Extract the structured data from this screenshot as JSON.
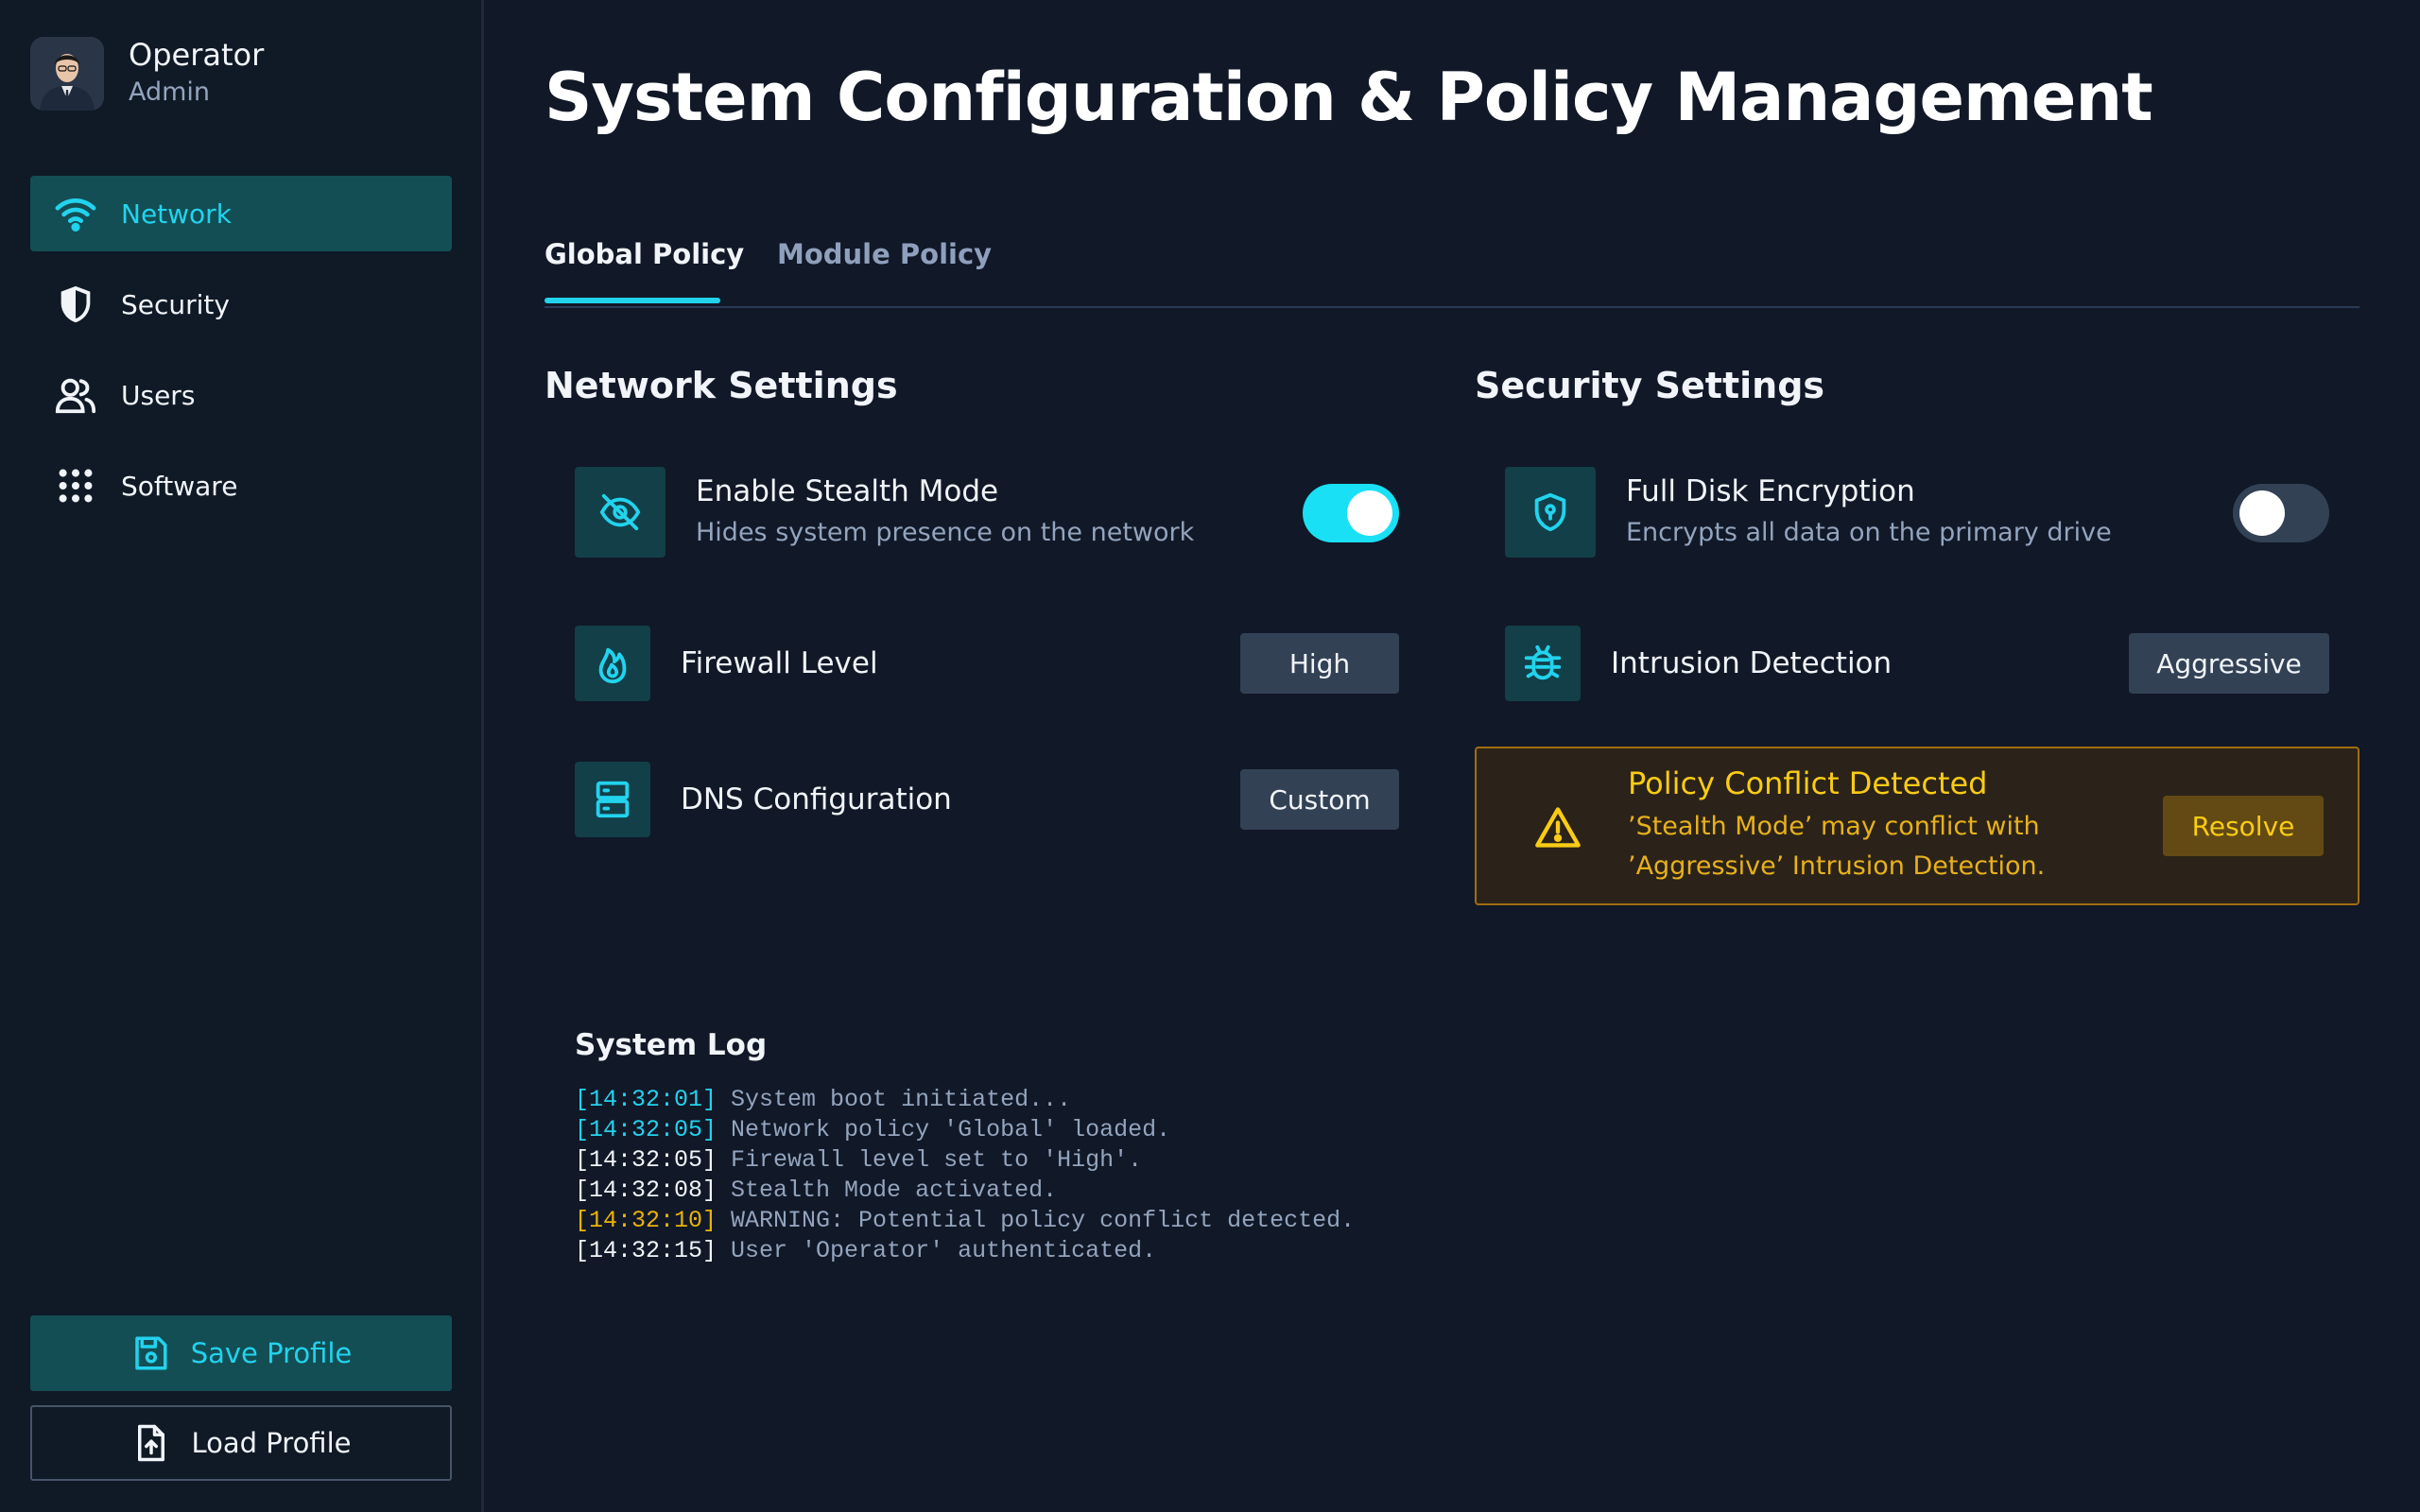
{
  "user": {
    "name": "Operator",
    "role": "Admin"
  },
  "nav": {
    "network": "Network",
    "security": "Security",
    "users": "Users",
    "software": "Software"
  },
  "buttons": {
    "save": "Save Profile",
    "load": "Load Profile"
  },
  "page_title": "System Configuration & Policy Management",
  "tabs": {
    "global": "Global Policy",
    "module": "Module Policy",
    "active": "global"
  },
  "network_settings": {
    "title": "Network Settings",
    "stealth": {
      "label": "Enable Stealth Mode",
      "desc": "Hides system presence on the network",
      "enabled": true,
      "icon": "eye-slash-icon"
    },
    "firewall": {
      "label": "Firewall Level",
      "value": "High",
      "icon": "fire-icon"
    },
    "dns": {
      "label": "DNS Configuration",
      "value": "Custom",
      "icon": "server-icon"
    }
  },
  "security_settings": {
    "title": "Security Settings",
    "encryption": {
      "label": "Full Disk Encryption",
      "desc": "Encrypts all data on the primary drive",
      "enabled": false,
      "icon": "shield-lock-icon"
    },
    "intrusion": {
      "label": "Intrusion Detection",
      "value": "Aggressive",
      "icon": "bug-icon"
    }
  },
  "alert": {
    "title": "Policy Conflict Detected",
    "line1": "’Stealth Mode’ may conflict with",
    "line2": "’Aggressive’ Intrusion Detection.",
    "action": "Resolve"
  },
  "log": {
    "title": "System Log",
    "entries": [
      {
        "time": "[14:32:01]",
        "msg": " System boot initiated...",
        "level": "info"
      },
      {
        "time": "[14:32:05]",
        "msg": " Network policy 'Global' loaded.",
        "level": "info"
      },
      {
        "time": "[14:32:05]",
        "msg": " Firewall level set to 'High'.",
        "level": "normal"
      },
      {
        "time": "[14:32:08]",
        "msg": " Stealth Mode activated.",
        "level": "normal"
      },
      {
        "time": "[14:32:10]",
        "msg": " WARNING: Potential policy conflict detected.",
        "level": "warning"
      },
      {
        "time": "[14:32:15]",
        "msg": " User 'Operator' authenticated.",
        "level": "normal"
      }
    ]
  },
  "colors": {
    "accent": "#22d3ee",
    "background": "#111827",
    "sidebar": "#101926",
    "warning": "#facc15"
  }
}
